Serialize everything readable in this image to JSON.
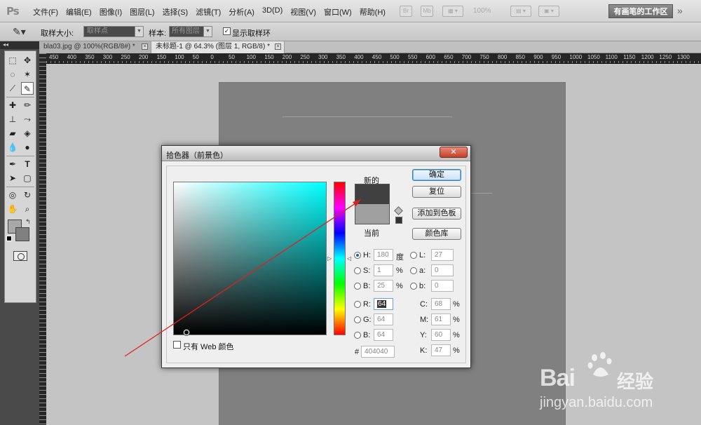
{
  "app": {
    "logo": "Ps",
    "menu": [
      "文件(F)",
      "编辑(E)",
      "图像(I)",
      "图层(L)",
      "选择(S)",
      "滤镜(T)",
      "分析(A)",
      "3D(D)",
      "视图(V)",
      "窗口(W)",
      "帮助(H)"
    ],
    "zoom": "100%",
    "workspace_label": "有画笔的工作区",
    "more_icon": "double-chevron-right-icon"
  },
  "options_bar": {
    "sample_size_label": "取样大小:",
    "sample_size_value": "取样点",
    "sample_label": "样本:",
    "sample_value": "所有图层",
    "show_ring_label": "显示取样环",
    "show_ring_checked": true
  },
  "tabs": [
    {
      "label": "bla03.jpg @ 100%(RGB/8#) *",
      "active": false
    },
    {
      "label": "未标题-1 @ 64.3% (图层 1, RGB/8) *",
      "active": true
    }
  ],
  "ruler_labels": [
    "450",
    "400",
    "350",
    "300",
    "250",
    "200",
    "150",
    "100",
    "50",
    "0",
    "50",
    "100",
    "150",
    "200",
    "250",
    "300",
    "350",
    "400",
    "450",
    "500",
    "550",
    "600",
    "650",
    "700",
    "750",
    "800",
    "850",
    "900",
    "950",
    "1000",
    "1050",
    "1100",
    "1150",
    "1200",
    "1250",
    "1300"
  ],
  "toolbox": {
    "foreground_color": "#a8a8a8",
    "background_color": "#808080"
  },
  "color_picker": {
    "title": "拾色器（前景色）",
    "close_label": "✕",
    "new_label": "新的",
    "current_label": "当前",
    "new_color": "#404040",
    "current_color": "#9f9f9f",
    "buttons": {
      "ok": "确定",
      "reset": "复位",
      "add_swatch": "添加到色板",
      "color_libraries": "颜色库"
    },
    "hsb": {
      "h_label": "H:",
      "h_value": "180",
      "h_unit": "度",
      "s_label": "S:",
      "s_value": "1",
      "s_unit": "%",
      "b_label": "B:",
      "b_value": "25",
      "b_unit": "%"
    },
    "rgb": {
      "r_label": "R:",
      "r_value": "64",
      "g_label": "G:",
      "g_value": "64",
      "b_label": "B:",
      "b_value": "64"
    },
    "lab": {
      "l_label": "L:",
      "l_value": "27",
      "a_label": "a:",
      "a_value": "0",
      "b_label": "b:",
      "b_value": "0"
    },
    "cmyk": {
      "c_label": "C:",
      "c_value": "68",
      "m_label": "M:",
      "m_value": "61",
      "y_label": "Y:",
      "y_value": "60",
      "k_label": "K:",
      "k_value": "47",
      "unit": "%"
    },
    "hex_label": "#",
    "hex_value": "404040",
    "web_only_label": "只有 Web 颜色",
    "web_only_checked": false
  },
  "watermark": {
    "brand_left": "Bai",
    "brand_right": "经验",
    "url": "jingyan.baidu.com"
  }
}
